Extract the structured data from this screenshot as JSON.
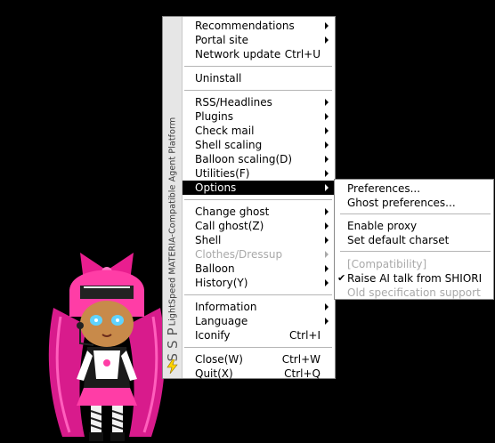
{
  "side_banner": {
    "product_text": "LightSpeed MATERIA-Compatible Agent Platform",
    "logo_text": "SSP"
  },
  "main_menu": {
    "items": [
      {
        "label": "Recommendations",
        "shortcut": "",
        "has_submenu": true,
        "enabled": true,
        "selected": false
      },
      {
        "label": "Portal site",
        "shortcut": "",
        "has_submenu": true,
        "enabled": true,
        "selected": false
      },
      {
        "label": "Network update",
        "shortcut": "Ctrl+U",
        "has_submenu": false,
        "enabled": true,
        "selected": false
      },
      {
        "label": "Uninstall",
        "shortcut": "",
        "has_submenu": false,
        "enabled": true,
        "selected": false
      },
      {
        "label": "RSS/Headlines",
        "shortcut": "",
        "has_submenu": true,
        "enabled": true,
        "selected": false
      },
      {
        "label": "Plugins",
        "shortcut": "",
        "has_submenu": true,
        "enabled": true,
        "selected": false
      },
      {
        "label": "Check mail",
        "shortcut": "",
        "has_submenu": true,
        "enabled": true,
        "selected": false
      },
      {
        "label": "Shell scaling",
        "shortcut": "",
        "has_submenu": true,
        "enabled": true,
        "selected": false
      },
      {
        "label": "Balloon scaling(D)",
        "shortcut": "",
        "has_submenu": true,
        "enabled": true,
        "selected": false
      },
      {
        "label": "Utilities(F)",
        "shortcut": "",
        "has_submenu": true,
        "enabled": true,
        "selected": false
      },
      {
        "label": "Options",
        "shortcut": "",
        "has_submenu": true,
        "enabled": true,
        "selected": true
      },
      {
        "label": "Change ghost",
        "shortcut": "",
        "has_submenu": true,
        "enabled": true,
        "selected": false
      },
      {
        "label": "Call ghost(Z)",
        "shortcut": "",
        "has_submenu": true,
        "enabled": true,
        "selected": false
      },
      {
        "label": "Shell",
        "shortcut": "",
        "has_submenu": true,
        "enabled": true,
        "selected": false
      },
      {
        "label": "Clothes/Dressup",
        "shortcut": "",
        "has_submenu": true,
        "enabled": false,
        "selected": false
      },
      {
        "label": "Balloon",
        "shortcut": "",
        "has_submenu": true,
        "enabled": true,
        "selected": false
      },
      {
        "label": "History(Y)",
        "shortcut": "",
        "has_submenu": true,
        "enabled": true,
        "selected": false
      },
      {
        "label": "Information",
        "shortcut": "",
        "has_submenu": true,
        "enabled": true,
        "selected": false
      },
      {
        "label": "Language",
        "shortcut": "",
        "has_submenu": true,
        "enabled": true,
        "selected": false
      },
      {
        "label": "Iconify",
        "shortcut": "Ctrl+I",
        "has_submenu": false,
        "enabled": true,
        "selected": false
      },
      {
        "label": "Close(W)",
        "shortcut": "Ctrl+W",
        "has_submenu": false,
        "enabled": true,
        "selected": false
      },
      {
        "label": "Quit(X)",
        "shortcut": "Ctrl+Q",
        "has_submenu": false,
        "enabled": true,
        "selected": false
      }
    ]
  },
  "options_submenu": {
    "items": [
      {
        "label": "Preferences...",
        "checked": false,
        "enabled": true
      },
      {
        "label": "Ghost preferences...",
        "checked": false,
        "enabled": true
      },
      {
        "label": "Enable proxy",
        "checked": false,
        "enabled": true
      },
      {
        "label": "Set default charset",
        "checked": false,
        "enabled": true
      },
      {
        "label": "[Compatibility]",
        "checked": false,
        "enabled": false
      },
      {
        "label": "Raise AI talk from SHIORI",
        "checked": true,
        "enabled": true
      },
      {
        "label": "Old specification support",
        "checked": false,
        "enabled": false
      }
    ]
  },
  "colors": {
    "selection": "#000000",
    "banner": "#e6e6e6",
    "disabled_text": "#a9a9a9"
  }
}
